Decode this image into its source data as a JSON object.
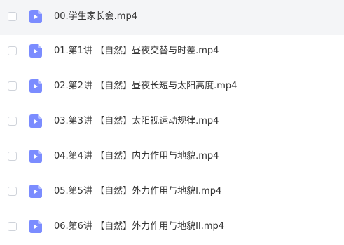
{
  "file_list": {
    "items": [
      {
        "name": "00.学生家长会.mp4",
        "icon": "video-file-icon"
      },
      {
        "name": "01.第1讲 【自然】昼夜交替与时差.mp4",
        "icon": "video-file-icon"
      },
      {
        "name": "02.第2讲 【自然】昼夜长短与太阳高度.mp4",
        "icon": "video-file-icon"
      },
      {
        "name": "03.第3讲 【自然】太阳视运动规律.mp4",
        "icon": "video-file-icon"
      },
      {
        "name": "04.第4讲 【自然】内力作用与地貌.mp4",
        "icon": "video-file-icon"
      },
      {
        "name": "05.第5讲 【自然】外力作用与地貌I.mp4",
        "icon": "video-file-icon"
      },
      {
        "name": "06.第6讲 【自然】外力作用与地貌II.mp4",
        "icon": "video-file-icon"
      }
    ]
  },
  "colors": {
    "icon_fill": "#7b8cff",
    "icon_fold": "#b3bdff",
    "first_row_background": "#f4f5f7"
  }
}
